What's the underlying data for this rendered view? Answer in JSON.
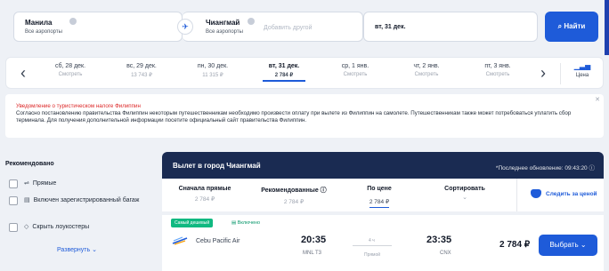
{
  "search": {
    "from_city": "Манила",
    "from_sub": "Все аэропорты",
    "to_city": "Чиангмай",
    "to_sub": "Все аэропорты",
    "to_add_placeholder": "Добавить другой",
    "date": "вт, 31 дек.",
    "search_button": "Найти",
    "search_icon": "search-icon",
    "swap_icon": "plane-icon"
  },
  "date_strip": {
    "days": [
      {
        "date": "сб, 28 дек.",
        "price": "Смотреть"
      },
      {
        "date": "вс, 29 дек.",
        "price": "13 743 ₽"
      },
      {
        "date": "пн, 30 дек.",
        "price": "11 315 ₽"
      },
      {
        "date": "вт, 31 дек.",
        "price": "2 784 ₽"
      },
      {
        "date": "ср, 1 янв.",
        "price": "Смотреть"
      },
      {
        "date": "чт, 2 янв.",
        "price": "Смотреть"
      },
      {
        "date": "пт, 3 янв.",
        "price": "Смотреть"
      }
    ],
    "active_index": 3,
    "price_label": "Цена",
    "price_icon": "bar-chart-icon"
  },
  "notice": {
    "title": "Уведомление о туристическом налоге Филиппин",
    "body": "Согласно постановлению правительства Филиппин некоторым путешественникам необходимо произвести оплату при вылете из Филиппин на самолете. Путешественникам также может потребоваться уплатить сбор терминала. Для получения дополнительной информации посетите официальный сайт правительства Филиппин."
  },
  "filters": {
    "heading": "Рекомендовано",
    "items": [
      {
        "label": "Прямые",
        "icon": "direct-icon"
      },
      {
        "label": "Включен зарегистрированный багаж",
        "icon": "luggage-icon"
      },
      {
        "label": "Скрыть лоукостеры",
        "icon": "tag-icon"
      }
    ],
    "expand_label": "Развернуть"
  },
  "results": {
    "title": "Вылет в город Чиангмай",
    "updated": "*Последнее обновление: 09:43:20",
    "sort": [
      {
        "label": "Сначала прямые",
        "value": "2 784 ₽"
      },
      {
        "label": "Рекомендованные ⓘ",
        "value": "2 784 ₽"
      },
      {
        "label": "По цене",
        "value": "2 784 ₽"
      },
      {
        "label": "Сортировать",
        "value": ""
      }
    ],
    "active_sort": 2,
    "follow_label": "Следить за ценой"
  },
  "flight": {
    "badge_cheapest": "Самый дешевый",
    "badge_included": "Включено",
    "airline": "Cebu Pacific Air",
    "depart_time": "20:35",
    "depart_airport": "MNL T3",
    "duration": "4 ч",
    "stops": "Прямой",
    "arrive_time": "23:35",
    "arrive_airport": "CNX",
    "price": "2 784 ₽",
    "select_label": "Выбрать"
  },
  "colors": {
    "accent": "#1e5bd9",
    "header_dark": "#1a2b52",
    "notice_red": "#dc2626",
    "badge_green": "#10b981"
  }
}
